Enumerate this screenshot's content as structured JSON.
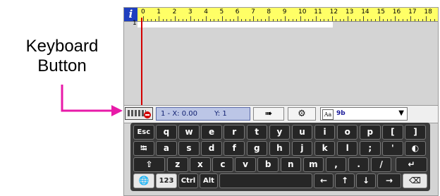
{
  "callout": {
    "line1": "Keyboard",
    "line2": "Button"
  },
  "colors": {
    "callout_arrow": "#e81aa8",
    "cursor": "#d40000",
    "ruler": "#ffff66",
    "info": "#1f3fbf"
  },
  "ruler": {
    "info_label": "i",
    "numbers": [
      "0",
      "1",
      "2",
      "3",
      "4",
      "5",
      "6",
      "7",
      "8",
      "9",
      "10",
      "11",
      "12",
      "13",
      "14",
      "15",
      "16",
      "17",
      "18"
    ]
  },
  "editor": {
    "line_number": "1"
  },
  "statusbar": {
    "keyboard_icon": "keyboard-icon",
    "x_label": "1 - X: 0.00",
    "y_label": "Y: 1",
    "next_symbol": "➠",
    "settings_symbol": "⚙",
    "font_aa": "Aa",
    "font_value": "9b",
    "dropdown_symbol": "▼"
  },
  "keyboard": {
    "row1": [
      "Esc",
      "q",
      "w",
      "e",
      "r",
      "t",
      "y",
      "u",
      "i",
      "o",
      "p",
      "[",
      "]"
    ],
    "row2": [
      "⭾",
      "a",
      "s",
      "d",
      "f",
      "g",
      "h",
      "j",
      "k",
      "l",
      ";",
      "'",
      "◐"
    ],
    "row3": [
      "⇧",
      "z",
      "x",
      "c",
      "v",
      "b",
      "n",
      "m",
      ",",
      ".",
      "/",
      "↵"
    ],
    "row4": {
      "globe": "🌐",
      "num": "123",
      "ctrl": "Ctrl",
      "alt": "Alt",
      "space": "",
      "left": "←",
      "up": "↑",
      "down": "↓",
      "right": "→",
      "bksp": "⌫"
    }
  }
}
